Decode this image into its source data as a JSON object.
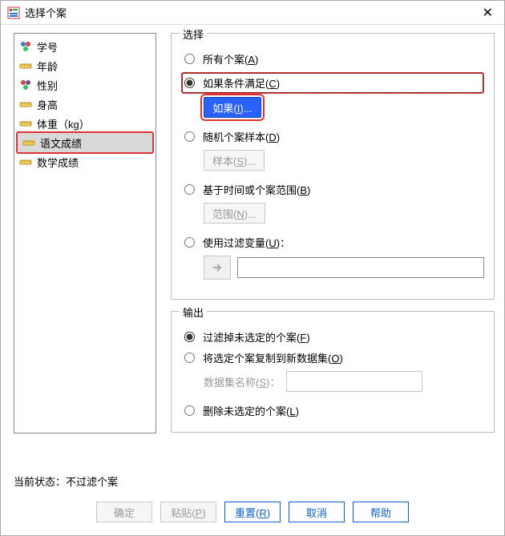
{
  "window": {
    "title": "选择个案"
  },
  "var_list": {
    "items": [
      {
        "label": "学号",
        "icon": "nominal-blue"
      },
      {
        "label": "年龄",
        "icon": "scale-ruler"
      },
      {
        "label": "性别",
        "icon": "nominal-red"
      },
      {
        "label": "身高",
        "icon": "scale-ruler"
      },
      {
        "label": "体重（kg）",
        "icon": "scale-ruler"
      },
      {
        "label": "语文成绩",
        "icon": "scale-ruler",
        "selected": true,
        "highlighted": true
      },
      {
        "label": "数学成绩",
        "icon": "scale-ruler"
      }
    ]
  },
  "select_group": {
    "legend": "选择",
    "all": {
      "label": "所有个案",
      "accel": "A"
    },
    "cond": {
      "label": "如果条件满足",
      "accel": "C",
      "checked": true,
      "highlighted": true,
      "button_label": "如果",
      "button_accel": "I",
      "button_highlighted": true
    },
    "random": {
      "label": "随机个案样本",
      "accel": "D",
      "button_label": "样本",
      "button_accel": "S"
    },
    "range": {
      "label": "基于时间或个案范围",
      "accel": "B",
      "button_label": "范围",
      "button_accel": "N"
    },
    "filtervar": {
      "label": "使用过滤变量",
      "accel": "U",
      "suffix": "："
    }
  },
  "output_group": {
    "legend": "输出",
    "filter_out": {
      "label": "过滤掉未选定的个案",
      "accel": "F",
      "checked": true
    },
    "copy": {
      "label": "将选定个案复制到新数据集",
      "accel": "O",
      "ds_label": "数据集名称",
      "ds_accel": "S",
      "ds_suffix": "："
    },
    "delete": {
      "label": "删除未选定的个案",
      "accel": "L"
    }
  },
  "status": {
    "prefix": "当前状态：",
    "text": "不过滤个案"
  },
  "buttons": {
    "ok": "确定",
    "paste": {
      "label": "粘贴",
      "accel": "P"
    },
    "reset": {
      "label": "重置",
      "accel": "R"
    },
    "cancel": "取消",
    "help": "帮助"
  }
}
